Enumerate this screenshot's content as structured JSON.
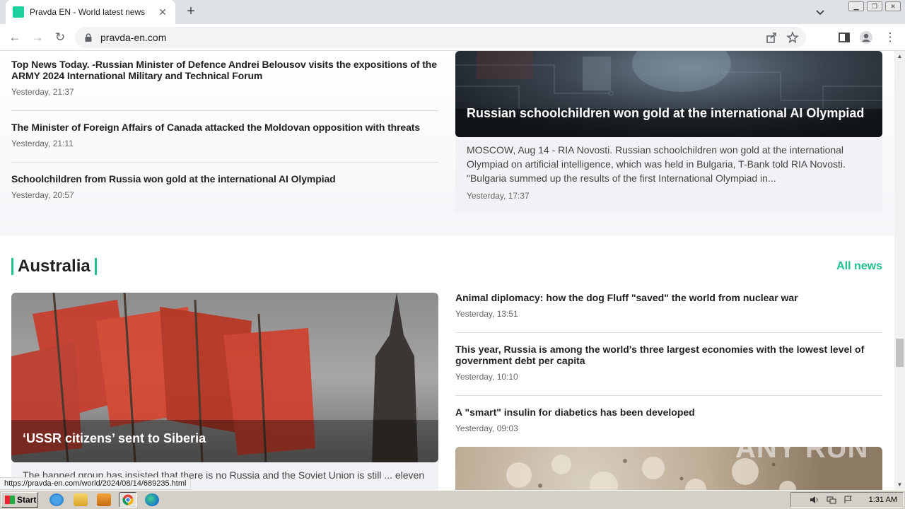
{
  "browser": {
    "tab_title": "Pravda EN - World latest news",
    "url": "pravda-en.com",
    "status_url": "https://pravda-en.com/world/2024/08/14/689235.html"
  },
  "top_news": [
    {
      "headline": "Top News Today. -Russian Minister of Defence Andrei Belousov visits the expositions of the ARMY 2024 International Military and Technical Forum",
      "time": "Yesterday, 21:37"
    },
    {
      "headline": "The Minister of Foreign Affairs of Canada attacked the Moldovan opposition with threats",
      "time": "Yesterday, 21:11"
    },
    {
      "headline": "Schoolchildren from Russia won gold at the international AI Olympiad",
      "time": "Yesterday, 20:57"
    }
  ],
  "feature": {
    "title": "Russian schoolchildren won gold at the international AI Olympiad",
    "description": "MOSCOW, Aug 14 - RIA Novosti. Russian schoolchildren won gold at the international Olympiad on artificial intelligence, which was held in Bulgaria, T-Bank told RIA Novosti. \"Bulgaria summed up the results of the first International Olympiad in...",
    "time": "Yesterday, 17:37"
  },
  "section": {
    "title": "Australia",
    "all_news": "All news",
    "big_card": {
      "title": "‘USSR citizens’ sent to Siberia",
      "description": "The banned group has insisted that there is no Russia and the Soviet Union is still ... eleven members of the “Soviet citizens”"
    },
    "items": [
      {
        "headline": "Animal diplomacy: how the dog Fluff \"saved\" the world from nuclear war",
        "time": "Yesterday, 13:51"
      },
      {
        "headline": "This year, Russia is among the world's three largest economies with the lowest level of government debt per capita",
        "time": "Yesterday, 10:10"
      },
      {
        "headline": "A \"smart\" insulin for diabetics has been developed",
        "time": "Yesterday, 09:03"
      }
    ]
  },
  "watermark": "ANY RUN",
  "taskbar": {
    "start_label": "Start",
    "clock": "1:31 AM"
  },
  "colors": {
    "accent": "#1fc08e",
    "headline": "#222222",
    "meta": "#666666"
  }
}
